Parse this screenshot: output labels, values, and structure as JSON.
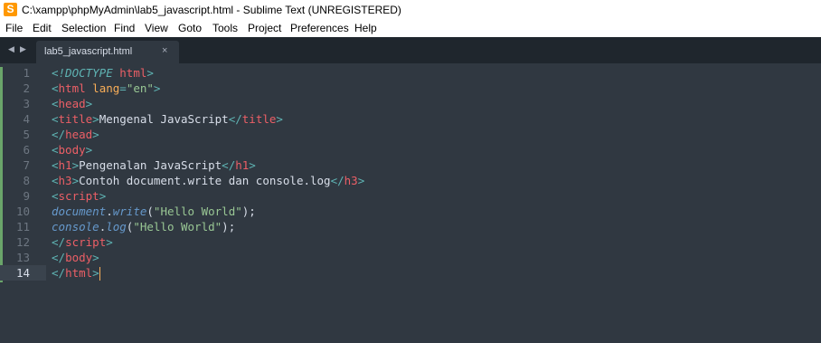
{
  "window": {
    "title": "C:\\xampp\\phpMyAdmin\\lab5_javascript.html - Sublime Text (UNREGISTERED)",
    "icon": "sublime-text-icon"
  },
  "menu": [
    "File",
    "Edit",
    "Selection",
    "Find",
    "View",
    "Goto",
    "Tools",
    "Project",
    "Preferences",
    "Help"
  ],
  "tabs": [
    {
      "label": "lab5_javascript.html",
      "close": "×",
      "active": true
    }
  ],
  "nav": {
    "back": "◀",
    "forward": "▶"
  },
  "editor": {
    "current_line": 14,
    "lines": [
      {
        "n": "1",
        "tokens": [
          [
            "punct",
            "<"
          ],
          [
            "doc",
            "!DOCTYPE "
          ],
          [
            "tag",
            "html"
          ],
          [
            "punct",
            ">"
          ]
        ]
      },
      {
        "n": "2",
        "tokens": [
          [
            "punct",
            "<"
          ],
          [
            "tag",
            "html"
          ],
          [
            "plain",
            " "
          ],
          [
            "attr",
            "lang"
          ],
          [
            "punct",
            "="
          ],
          [
            "str",
            "\"en\""
          ],
          [
            "punct",
            ">"
          ]
        ]
      },
      {
        "n": "3",
        "tokens": [
          [
            "punct",
            "<"
          ],
          [
            "tag",
            "head"
          ],
          [
            "punct",
            ">"
          ]
        ]
      },
      {
        "n": "4",
        "tokens": [
          [
            "punct",
            "<"
          ],
          [
            "tag",
            "title"
          ],
          [
            "punct",
            ">"
          ],
          [
            "plain",
            "Mengenal JavaScript"
          ],
          [
            "punct",
            "</"
          ],
          [
            "tag",
            "title"
          ],
          [
            "punct",
            ">"
          ]
        ]
      },
      {
        "n": "5",
        "tokens": [
          [
            "punct",
            "</"
          ],
          [
            "tag",
            "head"
          ],
          [
            "punct",
            ">"
          ]
        ]
      },
      {
        "n": "6",
        "tokens": [
          [
            "punct",
            "<"
          ],
          [
            "tag",
            "body"
          ],
          [
            "punct",
            ">"
          ]
        ]
      },
      {
        "n": "7",
        "tokens": [
          [
            "punct",
            "<"
          ],
          [
            "tag",
            "h1"
          ],
          [
            "punct",
            ">"
          ],
          [
            "plain",
            "Pengenalan JavaScript"
          ],
          [
            "punct",
            "</"
          ],
          [
            "tag",
            "h1"
          ],
          [
            "punct",
            ">"
          ]
        ]
      },
      {
        "n": "8",
        "tokens": [
          [
            "punct",
            "<"
          ],
          [
            "tag",
            "h3"
          ],
          [
            "punct",
            ">"
          ],
          [
            "plain",
            "Contoh document.write dan console.log"
          ],
          [
            "punct",
            "</"
          ],
          [
            "tag",
            "h3"
          ],
          [
            "punct",
            ">"
          ]
        ]
      },
      {
        "n": "9",
        "tokens": [
          [
            "punct",
            "<"
          ],
          [
            "tag",
            "script"
          ],
          [
            "punct",
            ">"
          ]
        ]
      },
      {
        "n": "10",
        "tokens": [
          [
            "obj",
            "document"
          ],
          [
            "plain",
            "."
          ],
          [
            "fn",
            "write"
          ],
          [
            "plain",
            "("
          ],
          [
            "str",
            "\"Hello World\""
          ],
          [
            "plain",
            ");"
          ]
        ]
      },
      {
        "n": "11",
        "tokens": [
          [
            "obj",
            "console"
          ],
          [
            "plain",
            "."
          ],
          [
            "fn",
            "log"
          ],
          [
            "plain",
            "("
          ],
          [
            "str",
            "\"Hello World\""
          ],
          [
            "plain",
            ");"
          ]
        ]
      },
      {
        "n": "12",
        "tokens": [
          [
            "punct",
            "</"
          ],
          [
            "tag",
            "script"
          ],
          [
            "punct",
            ">"
          ]
        ]
      },
      {
        "n": "13",
        "tokens": [
          [
            "punct",
            "</"
          ],
          [
            "tag",
            "body"
          ],
          [
            "punct",
            ">"
          ]
        ]
      },
      {
        "n": "14",
        "tokens": [
          [
            "punct",
            "</"
          ],
          [
            "tag",
            "html"
          ],
          [
            "punct",
            ">"
          ]
        ]
      }
    ]
  },
  "colors": {
    "background": "#303841",
    "tabbar": "#1f262d",
    "tag": "#ec5f66",
    "string": "#99c794",
    "attribute": "#f9ae58",
    "punctuation": "#5fb4b4",
    "js_object": "#6699cc"
  }
}
